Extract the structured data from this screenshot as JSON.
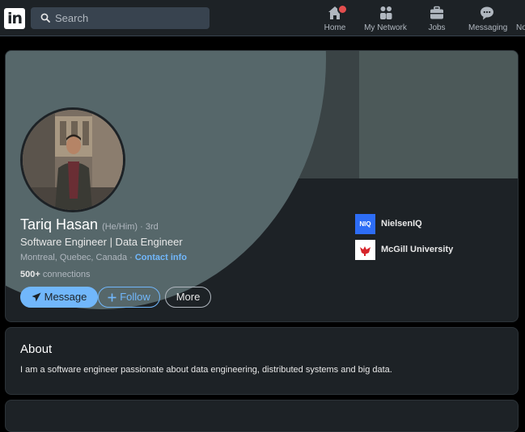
{
  "nav": {
    "logo_text": "in",
    "search_placeholder": "Search",
    "items": [
      {
        "label": "Home",
        "icon": "home-icon"
      },
      {
        "label": "My Network",
        "icon": "network-icon"
      },
      {
        "label": "Jobs",
        "icon": "jobs-icon"
      },
      {
        "label": "Messaging",
        "icon": "messaging-icon"
      },
      {
        "label": "No",
        "icon": "notifications-icon"
      }
    ]
  },
  "profile": {
    "name": "Tariq Hasan",
    "pronouns": "(He/Him)",
    "degree": " · 3rd",
    "headline": "Software Engineer | Data Engineer",
    "location": "Montreal, Quebec, Canada · ",
    "contact_info": "Contact info",
    "connections_count": "500+",
    "connections_label": " connections",
    "buttons": {
      "message": "Message",
      "follow": "Follow",
      "more": "More"
    },
    "organizations": [
      {
        "name": "NielsenIQ",
        "logo_text": "NIQ"
      },
      {
        "name": "McGill University"
      }
    ]
  },
  "about": {
    "title": "About",
    "text": "I am a software engineer passionate about data engineering, distributed systems and big data."
  },
  "colors": {
    "accent": "#71b7fb",
    "card_bg": "#1d2226",
    "badge": "#e34e4e",
    "niq_blue": "#2d6df6"
  }
}
